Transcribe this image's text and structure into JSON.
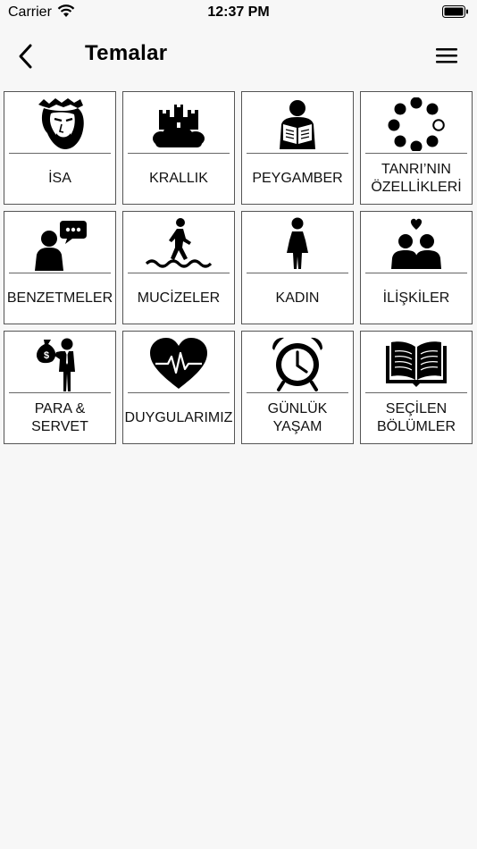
{
  "status": {
    "carrier": "Carrier",
    "time": "12:37 PM"
  },
  "nav": {
    "title": "Temalar"
  },
  "tiles": [
    {
      "label": "İSA",
      "icon": "jesus-icon"
    },
    {
      "label": "KRALLIK",
      "icon": "castle-icon"
    },
    {
      "label": "PEYGAMBER",
      "icon": "prophet-reading-icon"
    },
    {
      "label": "TANRI’NIN\nÖZELLİKLERİ",
      "icon": "dots-circle-icon"
    },
    {
      "label": "BENZETMELER",
      "icon": "speaking-person-icon"
    },
    {
      "label": "MUCİZELER",
      "icon": "walking-on-water-icon"
    },
    {
      "label": "KADIN",
      "icon": "woman-icon"
    },
    {
      "label": "İLİŞKİLER",
      "icon": "couple-heart-icon"
    },
    {
      "label": "PARA & SERVET",
      "icon": "money-bag-man-icon"
    },
    {
      "label": "DUYGULARIMIZ",
      "icon": "heartbeat-icon"
    },
    {
      "label": "GÜNLÜK YAŞAM",
      "icon": "alarm-clock-icon"
    },
    {
      "label": "SEÇİLEN\nBÖLÜMLER",
      "icon": "open-book-icon"
    }
  ]
}
